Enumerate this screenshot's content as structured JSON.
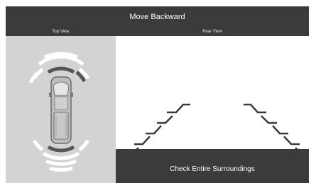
{
  "header": {
    "title": "Move Backward"
  },
  "views": {
    "top_view_label": "Top View",
    "rear_view_label": "Rear View"
  },
  "message": {
    "text": "Check Entire Surroundings"
  },
  "colors": {
    "bar": "#3b3b3b",
    "top_view_bg": "#d3d3d3",
    "sensor_active": "#555555",
    "sensor_inactive": "#ffffff",
    "guide_line": "#3b3b3b"
  },
  "sensors": {
    "front": [
      "inactive",
      "inactive",
      "active"
    ],
    "rear": [
      "inactive",
      "inactive",
      "active"
    ]
  }
}
